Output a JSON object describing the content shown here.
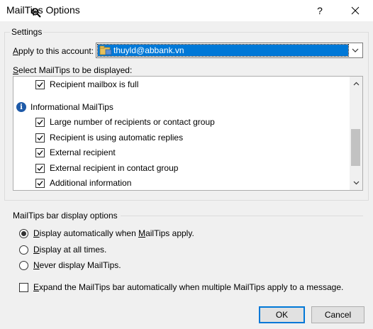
{
  "window": {
    "title": "MailTips Options",
    "help_glyph": "?",
    "close_glyph": "✕"
  },
  "settings": {
    "group_label": "Settings",
    "account_label": "Apply to this account:",
    "account_value": "thuyld@abbank.vn",
    "select_label": "Select MailTips to be displayed:",
    "list": {
      "items": [
        {
          "label": "Recipient mailbox is full",
          "checked": true
        },
        {
          "label": "Informational MailTips",
          "header": true
        },
        {
          "label": "Large number of recipients or contact group",
          "checked": true
        },
        {
          "label": "Recipient is using automatic replies",
          "checked": true
        },
        {
          "label": "External recipient",
          "checked": true
        },
        {
          "label": "External recipient in contact group",
          "checked": true
        },
        {
          "label": "Additional information",
          "checked": true
        }
      ]
    }
  },
  "bar_options": {
    "group_label": "MailTips bar display options",
    "radios": [
      {
        "label": "Display automatically when MailTips apply.",
        "selected": true
      },
      {
        "label": "Display at all times.",
        "selected": false
      },
      {
        "label": "Never display MailTips.",
        "selected": false
      }
    ],
    "expand_label": "Expand the MailTips bar automatically when multiple MailTips apply to a message.",
    "expand_checked": false
  },
  "buttons": {
    "ok": "OK",
    "cancel": "Cancel"
  },
  "colors": {
    "selection": "#0078d7",
    "info_icon": "#1e5aa8",
    "dialog_bg": "#f0f0f0"
  }
}
